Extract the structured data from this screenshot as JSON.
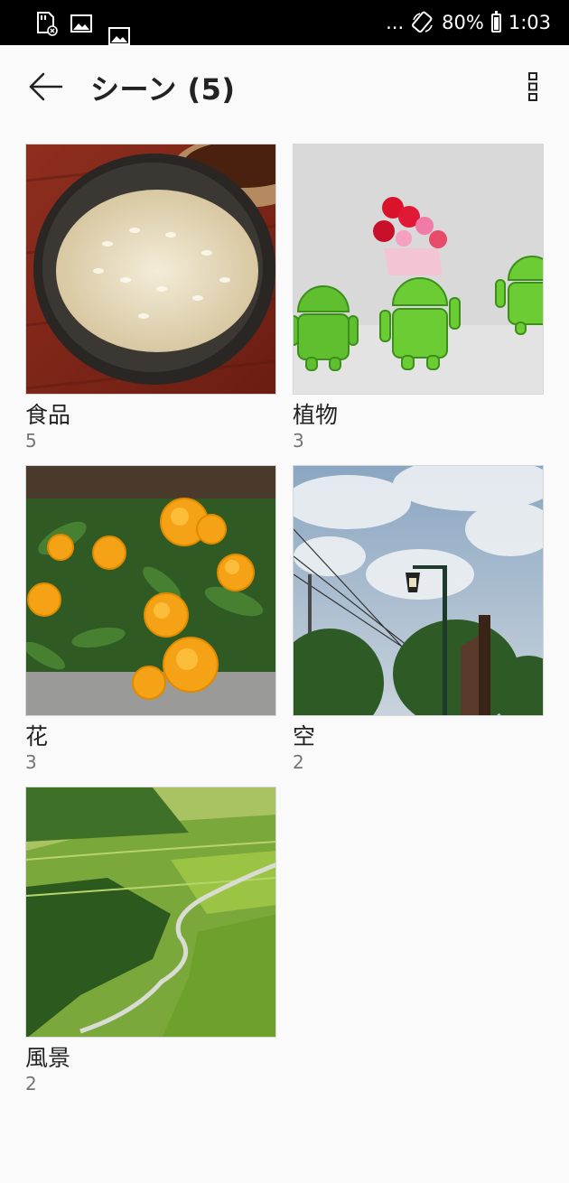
{
  "status_bar": {
    "left_icons": [
      "sd-card-icon",
      "image-icon",
      "image-icon"
    ],
    "dots": "...",
    "battery_percent": "80%",
    "battery_level": 0.8,
    "time": "1:03"
  },
  "app_bar": {
    "title": "シーン (5)"
  },
  "albums": [
    {
      "name": "食品",
      "count": "5"
    },
    {
      "name": "植物",
      "count": "3"
    },
    {
      "name": "花",
      "count": "3"
    },
    {
      "name": "空",
      "count": "2"
    },
    {
      "name": "風景",
      "count": "2"
    }
  ]
}
